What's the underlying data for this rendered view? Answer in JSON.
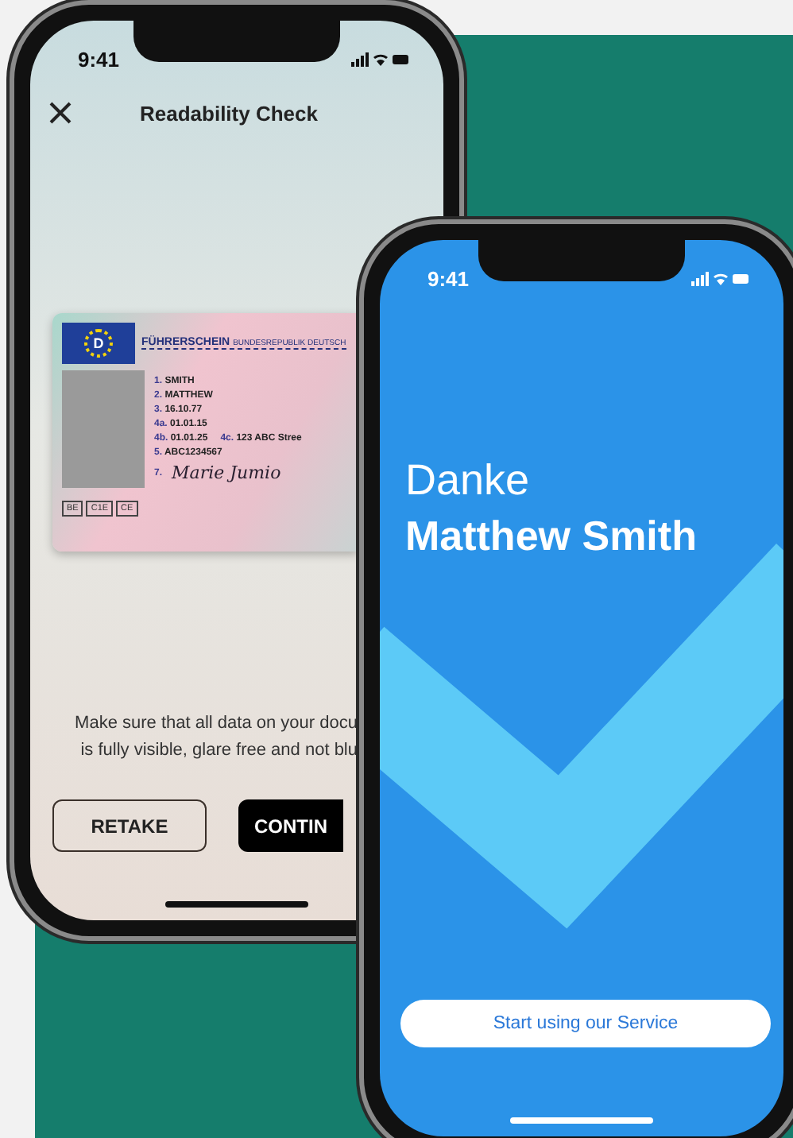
{
  "scan_phone": {
    "status_time": "9:41",
    "title": "Readability Check",
    "license": {
      "emblem": "D",
      "header": "FÜHRERSCHEIN",
      "country": "BUNDESREPUBLIK DEUTSCH",
      "rows": [
        [
          {
            "num": "1.",
            "value": "SMITH"
          }
        ],
        [
          {
            "num": "2.",
            "value": "MATTHEW"
          }
        ],
        [
          {
            "num": "3.",
            "value": "16.10.77"
          }
        ],
        [
          {
            "num": "4a.",
            "value": "01.01.15"
          }
        ],
        [
          {
            "num": "4b.",
            "value": "01.01.25"
          },
          {
            "num": "4c.",
            "value": "123 ABC Stree"
          }
        ],
        [
          {
            "num": "5.",
            "value": "ABC1234567"
          }
        ]
      ],
      "signature_num": "7.",
      "signature": "Marie Jumio",
      "categories": [
        "BE",
        "C1E",
        "CE"
      ]
    },
    "hint_lines": [
      "Make sure that all data on your docu",
      "is fully visible, glare free and not blu"
    ],
    "buttons": [
      {
        "label": "RETAKE",
        "kind": "outline"
      },
      {
        "label": "CONTIN",
        "kind": "solid"
      }
    ]
  },
  "done_phone": {
    "status_time": "9:41",
    "greeting": "Danke",
    "name": "Matthew Smith",
    "button": "Start using our Service"
  }
}
